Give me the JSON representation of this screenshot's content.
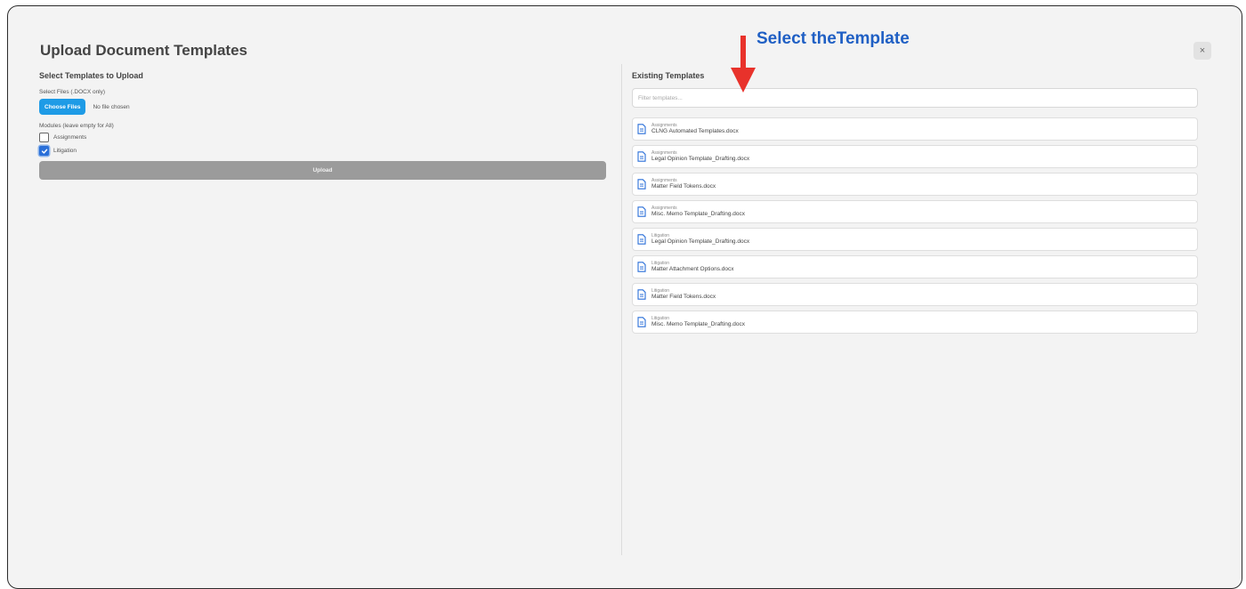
{
  "dialog": {
    "title": "Upload Document Templates",
    "close_label": "×"
  },
  "left": {
    "section_title": "Select Templates to Upload",
    "files_label": "Select Files (.DOCX only)",
    "choose_files_label": "Choose Files",
    "no_file_text": "No file chosen",
    "modules_label": "Modules (leave empty for All)",
    "modules": [
      {
        "label": "Assignments",
        "checked": false
      },
      {
        "label": "Litigation",
        "checked": true
      }
    ],
    "upload_label": "Upload"
  },
  "right": {
    "section_title": "Existing Templates",
    "filter_placeholder": "Filter templates...",
    "templates": [
      {
        "module": "Assignments",
        "name": "CLNG Automated Templates.docx"
      },
      {
        "module": "Assignments",
        "name": "Legal Opinion Template_Drafting.docx"
      },
      {
        "module": "Assignments",
        "name": "Matter Field Tokens.docx"
      },
      {
        "module": "Assignments",
        "name": "Misc. Memo Template_Drafting.docx"
      },
      {
        "module": "Litigation",
        "name": "Legal Opinion Template_Drafting.docx"
      },
      {
        "module": "Litigation",
        "name": "Matter Attachment Options.docx"
      },
      {
        "module": "Litigation",
        "name": "Matter Field Tokens.docx"
      },
      {
        "module": "Litigation",
        "name": "Misc. Memo Template_Drafting.docx"
      }
    ]
  },
  "annotation": {
    "text": "Select theTemplate",
    "text_color": "#1f5fc4",
    "arrow_color": "#e8322b"
  },
  "colors": {
    "primary_button": "#1e9be6",
    "disabled_button": "#9b9b9b",
    "checkbox_checked": "#2a6fd8",
    "doc_icon": "#2a6fd8"
  }
}
